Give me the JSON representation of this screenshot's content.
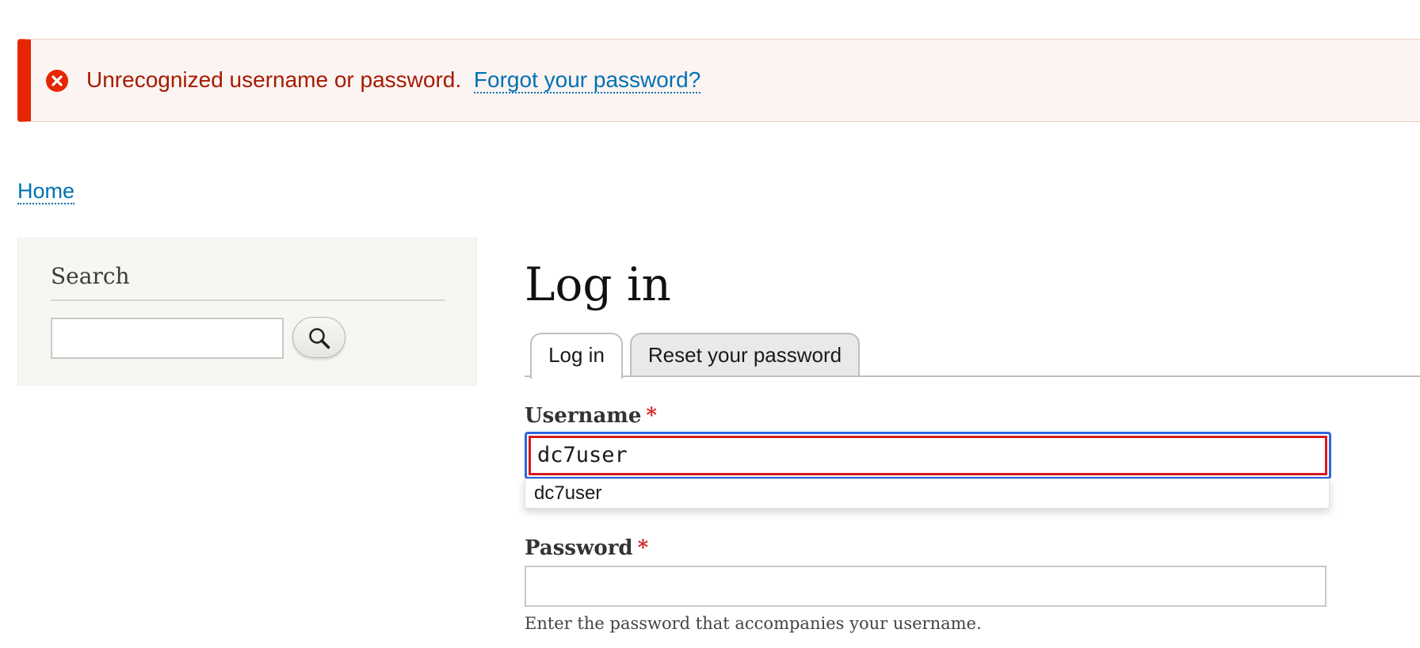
{
  "messages": {
    "error_text": "Unrecognized username or password.",
    "link_text": "Forgot your password?",
    "icon": "error-circle-x-icon",
    "colors": {
      "accent": "#e62600",
      "background": "#fcf4f2",
      "text": "#a51b00",
      "link": "#0071b3"
    }
  },
  "breadcrumb": {
    "home_label": "Home"
  },
  "sidebar": {
    "search_block": {
      "title": "Search",
      "input_value": "",
      "button_icon": "magnifier-icon"
    }
  },
  "main": {
    "page_title": "Log in",
    "tabs": [
      {
        "label": "Log in",
        "active": true
      },
      {
        "label": "Reset your password",
        "active": false
      }
    ],
    "username": {
      "label": "Username",
      "required_marker": "*",
      "value": "dc7user",
      "autocomplete_suggestions": [
        "dc7user"
      ]
    },
    "password": {
      "label": "Password",
      "required_marker": "*",
      "value": "",
      "description": "Enter the password that accompanies your username."
    }
  }
}
